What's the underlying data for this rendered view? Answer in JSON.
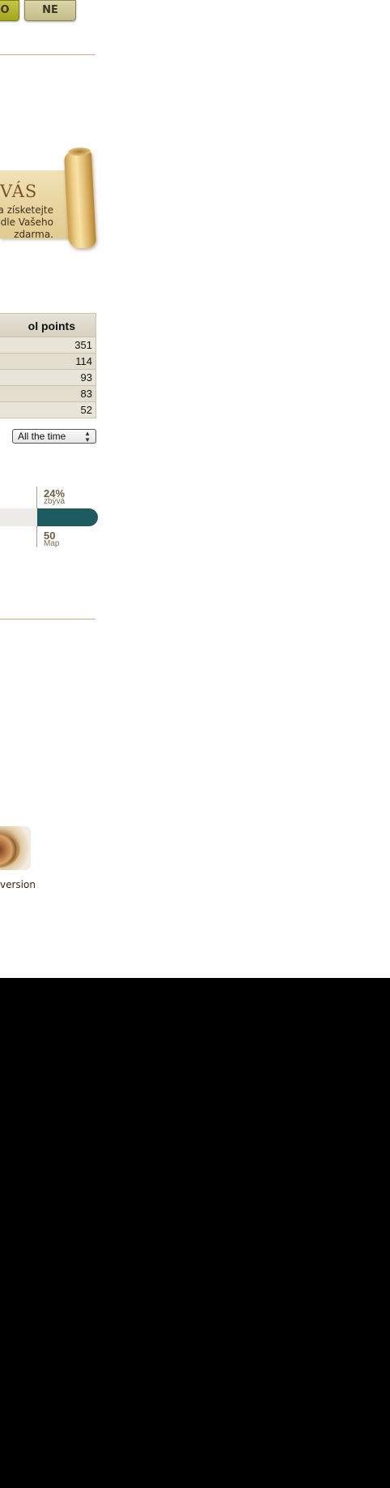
{
  "top_buttons": {
    "yes_label": "O",
    "no_label": "NE"
  },
  "banner": {
    "title": "VÁS",
    "lines": [
      "a získetejte",
      "dle Vašeho",
      "zdarma."
    ]
  },
  "points_table": {
    "header": "ol points",
    "rows": [
      "351",
      "114",
      "93",
      "83",
      "52"
    ]
  },
  "period_select": {
    "value": "All the time"
  },
  "progress": {
    "percent_text": "24%",
    "percent_label": "zbývá",
    "count_text": "50",
    "count_label": "Map",
    "fill_fraction": 0.24
  },
  "app": {
    "link_text": "version",
    "icon": "compass-icon"
  },
  "colors": {
    "progress_fill": "#1e5b60",
    "divider": "#c8ae86",
    "yes_button": "#b5b731",
    "no_button": "#cfc797"
  }
}
